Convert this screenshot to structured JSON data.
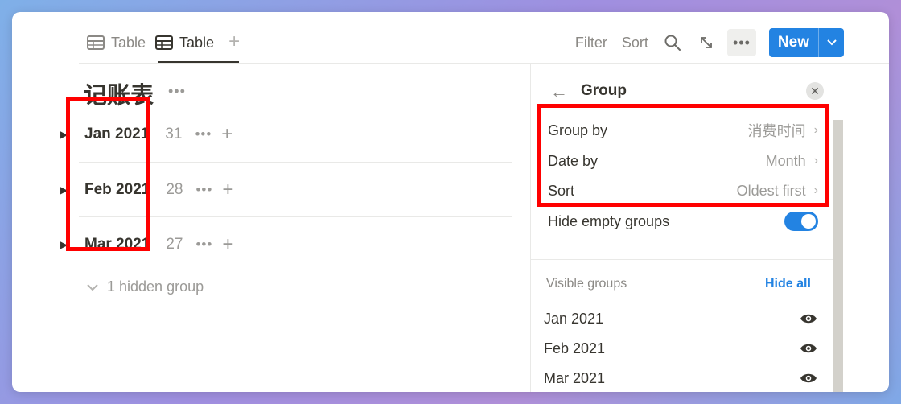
{
  "tabs": [
    {
      "label": "Table",
      "icon": "table-icon",
      "active": false
    },
    {
      "label": "Table",
      "icon": "table-icon",
      "active": true
    }
  ],
  "toolbar": {
    "filter_label": "Filter",
    "sort_label": "Sort",
    "new_label": "New"
  },
  "page": {
    "title": "记账表"
  },
  "groups": [
    {
      "label": "Jan 2021",
      "count": "31"
    },
    {
      "label": "Feb 2021",
      "count": "28"
    },
    {
      "label": "Mar 2021",
      "count": "27"
    }
  ],
  "hidden_groups_label": "1 hidden group",
  "panel": {
    "title": "Group",
    "rows": [
      {
        "label": "Group by",
        "value": "消费时间"
      },
      {
        "label": "Date by",
        "value": "Month"
      },
      {
        "label": "Sort",
        "value": "Oldest first"
      }
    ],
    "hide_empty_label": "Hide empty groups",
    "hide_empty_on": true,
    "visible_groups_label": "Visible groups",
    "hide_all_label": "Hide all",
    "visible_groups": [
      "Jan 2021",
      "Feb 2021",
      "Mar 2021"
    ]
  },
  "colors": {
    "accent": "#2383e2",
    "highlight": "#ff0000",
    "text": "#37352f",
    "muted": "#9b9a97"
  }
}
